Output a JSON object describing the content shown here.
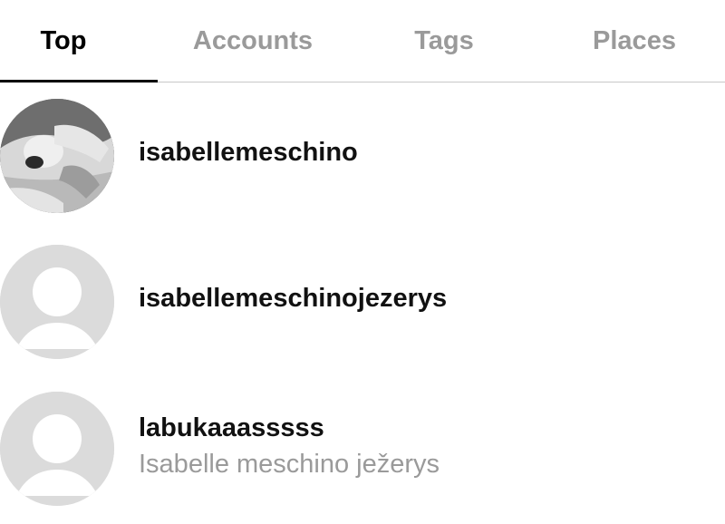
{
  "tabs": [
    {
      "label": "Top",
      "active": true
    },
    {
      "label": "Accounts",
      "active": false
    },
    {
      "label": "Tags",
      "active": false
    },
    {
      "label": "Places",
      "active": false
    }
  ],
  "results": [
    {
      "username": "isabellemeschino",
      "full_name": "",
      "avatar": "photo"
    },
    {
      "username": "isabellemeschinojezerys",
      "full_name": "",
      "avatar": "default-user-icon"
    },
    {
      "username": "labukaaasssss",
      "full_name": "Isabelle meschino ježerys",
      "avatar": "default-user-icon"
    }
  ],
  "colors": {
    "active_tab": "#000000",
    "inactive_tab": "#9a9a9a",
    "divider": "#c8c8c8",
    "placeholder_avatar": "#dbdbdb"
  }
}
